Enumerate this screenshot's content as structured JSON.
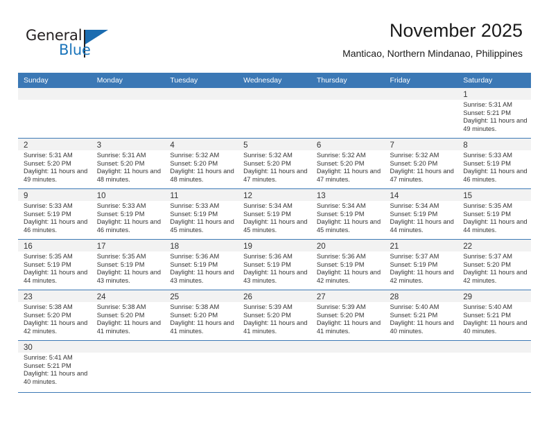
{
  "brand": {
    "name_top": "General",
    "name_bottom": "Blue",
    "flag_color": "#1b6cb0",
    "text_color": "#231f20"
  },
  "header": {
    "title": "November 2025",
    "subtitle": "Manticao, Northern Mindanao, Philippines"
  },
  "theme": {
    "header_blue": "#3b78b5",
    "daynum_strip": "#f2f2f2",
    "grid_line": "#3b78b5"
  },
  "weekday_headers": [
    "Sunday",
    "Monday",
    "Tuesday",
    "Wednesday",
    "Thursday",
    "Friday",
    "Saturday"
  ],
  "weeks": [
    [
      {
        "day": "",
        "sunrise": "",
        "sunset": "",
        "daylight": "",
        "empty": true
      },
      {
        "day": "",
        "sunrise": "",
        "sunset": "",
        "daylight": "",
        "empty": true
      },
      {
        "day": "",
        "sunrise": "",
        "sunset": "",
        "daylight": "",
        "empty": true
      },
      {
        "day": "",
        "sunrise": "",
        "sunset": "",
        "daylight": "",
        "empty": true
      },
      {
        "day": "",
        "sunrise": "",
        "sunset": "",
        "daylight": "",
        "empty": true
      },
      {
        "day": "",
        "sunrise": "",
        "sunset": "",
        "daylight": "",
        "empty": true
      },
      {
        "day": "1",
        "sunrise": "Sunrise: 5:31 AM",
        "sunset": "Sunset: 5:21 PM",
        "daylight": "Daylight: 11 hours and 49 minutes."
      }
    ],
    [
      {
        "day": "2",
        "sunrise": "Sunrise: 5:31 AM",
        "sunset": "Sunset: 5:20 PM",
        "daylight": "Daylight: 11 hours and 49 minutes."
      },
      {
        "day": "3",
        "sunrise": "Sunrise: 5:31 AM",
        "sunset": "Sunset: 5:20 PM",
        "daylight": "Daylight: 11 hours and 48 minutes."
      },
      {
        "day": "4",
        "sunrise": "Sunrise: 5:32 AM",
        "sunset": "Sunset: 5:20 PM",
        "daylight": "Daylight: 11 hours and 48 minutes."
      },
      {
        "day": "5",
        "sunrise": "Sunrise: 5:32 AM",
        "sunset": "Sunset: 5:20 PM",
        "daylight": "Daylight: 11 hours and 47 minutes."
      },
      {
        "day": "6",
        "sunrise": "Sunrise: 5:32 AM",
        "sunset": "Sunset: 5:20 PM",
        "daylight": "Daylight: 11 hours and 47 minutes."
      },
      {
        "day": "7",
        "sunrise": "Sunrise: 5:32 AM",
        "sunset": "Sunset: 5:20 PM",
        "daylight": "Daylight: 11 hours and 47 minutes."
      },
      {
        "day": "8",
        "sunrise": "Sunrise: 5:33 AM",
        "sunset": "Sunset: 5:19 PM",
        "daylight": "Daylight: 11 hours and 46 minutes."
      }
    ],
    [
      {
        "day": "9",
        "sunrise": "Sunrise: 5:33 AM",
        "sunset": "Sunset: 5:19 PM",
        "daylight": "Daylight: 11 hours and 46 minutes."
      },
      {
        "day": "10",
        "sunrise": "Sunrise: 5:33 AM",
        "sunset": "Sunset: 5:19 PM",
        "daylight": "Daylight: 11 hours and 46 minutes."
      },
      {
        "day": "11",
        "sunrise": "Sunrise: 5:33 AM",
        "sunset": "Sunset: 5:19 PM",
        "daylight": "Daylight: 11 hours and 45 minutes."
      },
      {
        "day": "12",
        "sunrise": "Sunrise: 5:34 AM",
        "sunset": "Sunset: 5:19 PM",
        "daylight": "Daylight: 11 hours and 45 minutes."
      },
      {
        "day": "13",
        "sunrise": "Sunrise: 5:34 AM",
        "sunset": "Sunset: 5:19 PM",
        "daylight": "Daylight: 11 hours and 45 minutes."
      },
      {
        "day": "14",
        "sunrise": "Sunrise: 5:34 AM",
        "sunset": "Sunset: 5:19 PM",
        "daylight": "Daylight: 11 hours and 44 minutes."
      },
      {
        "day": "15",
        "sunrise": "Sunrise: 5:35 AM",
        "sunset": "Sunset: 5:19 PM",
        "daylight": "Daylight: 11 hours and 44 minutes."
      }
    ],
    [
      {
        "day": "16",
        "sunrise": "Sunrise: 5:35 AM",
        "sunset": "Sunset: 5:19 PM",
        "daylight": "Daylight: 11 hours and 44 minutes."
      },
      {
        "day": "17",
        "sunrise": "Sunrise: 5:35 AM",
        "sunset": "Sunset: 5:19 PM",
        "daylight": "Daylight: 11 hours and 43 minutes."
      },
      {
        "day": "18",
        "sunrise": "Sunrise: 5:36 AM",
        "sunset": "Sunset: 5:19 PM",
        "daylight": "Daylight: 11 hours and 43 minutes."
      },
      {
        "day": "19",
        "sunrise": "Sunrise: 5:36 AM",
        "sunset": "Sunset: 5:19 PM",
        "daylight": "Daylight: 11 hours and 43 minutes."
      },
      {
        "day": "20",
        "sunrise": "Sunrise: 5:36 AM",
        "sunset": "Sunset: 5:19 PM",
        "daylight": "Daylight: 11 hours and 42 minutes."
      },
      {
        "day": "21",
        "sunrise": "Sunrise: 5:37 AM",
        "sunset": "Sunset: 5:19 PM",
        "daylight": "Daylight: 11 hours and 42 minutes."
      },
      {
        "day": "22",
        "sunrise": "Sunrise: 5:37 AM",
        "sunset": "Sunset: 5:20 PM",
        "daylight": "Daylight: 11 hours and 42 minutes."
      }
    ],
    [
      {
        "day": "23",
        "sunrise": "Sunrise: 5:38 AM",
        "sunset": "Sunset: 5:20 PM",
        "daylight": "Daylight: 11 hours and 42 minutes."
      },
      {
        "day": "24",
        "sunrise": "Sunrise: 5:38 AM",
        "sunset": "Sunset: 5:20 PM",
        "daylight": "Daylight: 11 hours and 41 minutes."
      },
      {
        "day": "25",
        "sunrise": "Sunrise: 5:38 AM",
        "sunset": "Sunset: 5:20 PM",
        "daylight": "Daylight: 11 hours and 41 minutes."
      },
      {
        "day": "26",
        "sunrise": "Sunrise: 5:39 AM",
        "sunset": "Sunset: 5:20 PM",
        "daylight": "Daylight: 11 hours and 41 minutes."
      },
      {
        "day": "27",
        "sunrise": "Sunrise: 5:39 AM",
        "sunset": "Sunset: 5:20 PM",
        "daylight": "Daylight: 11 hours and 41 minutes."
      },
      {
        "day": "28",
        "sunrise": "Sunrise: 5:40 AM",
        "sunset": "Sunset: 5:21 PM",
        "daylight": "Daylight: 11 hours and 40 minutes."
      },
      {
        "day": "29",
        "sunrise": "Sunrise: 5:40 AM",
        "sunset": "Sunset: 5:21 PM",
        "daylight": "Daylight: 11 hours and 40 minutes."
      }
    ],
    [
      {
        "day": "30",
        "sunrise": "Sunrise: 5:41 AM",
        "sunset": "Sunset: 5:21 PM",
        "daylight": "Daylight: 11 hours and 40 minutes."
      },
      {
        "day": "",
        "sunrise": "",
        "sunset": "",
        "daylight": "",
        "empty": true
      },
      {
        "day": "",
        "sunrise": "",
        "sunset": "",
        "daylight": "",
        "empty": true
      },
      {
        "day": "",
        "sunrise": "",
        "sunset": "",
        "daylight": "",
        "empty": true
      },
      {
        "day": "",
        "sunrise": "",
        "sunset": "",
        "daylight": "",
        "empty": true
      },
      {
        "day": "",
        "sunrise": "",
        "sunset": "",
        "daylight": "",
        "empty": true
      },
      {
        "day": "",
        "sunrise": "",
        "sunset": "",
        "daylight": "",
        "empty": true
      }
    ]
  ]
}
